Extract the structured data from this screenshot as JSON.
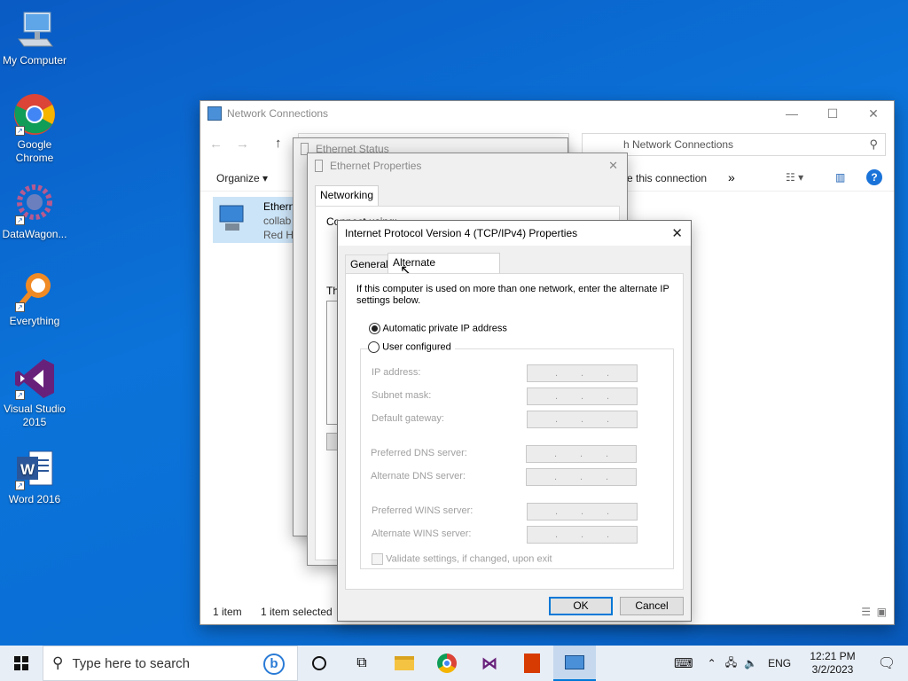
{
  "desktop": {
    "icons": [
      {
        "label": "My Computer"
      },
      {
        "label": "Google Chrome"
      },
      {
        "label": "DataWagon..."
      },
      {
        "label": "Everything"
      },
      {
        "label": "Visual Studio 2015"
      },
      {
        "label": "Word 2016"
      }
    ]
  },
  "network_window": {
    "title": "Network Connections",
    "search_placeholder": "h Network Connections",
    "toolbar_organize": "Organize",
    "toolbar_rename": "e this connection",
    "toolbar_more": "»",
    "item_name": "Ethern",
    "item_line2": "collab",
    "item_line3": "Red Ha",
    "status_count": "1 item",
    "status_selected": "1 item selected"
  },
  "ethernet_status": {
    "title": "Ethernet Status"
  },
  "ethernet_properties": {
    "title": "Ethernet Properties",
    "tab_networking": "Networking",
    "connect_using": "Connect using:",
    "this_conn": "Th"
  },
  "ipv4_dialog": {
    "title": "Internet Protocol Version 4 (TCP/IPv4) Properties",
    "tabs": [
      "General",
      "Alternate Configuration"
    ],
    "description": "If this computer is used on more than one network, enter the alternate IP settings below.",
    "radio_auto": "Automatic private IP address",
    "radio_user": "User configured",
    "fields": [
      {
        "label": "IP address:"
      },
      {
        "label": "Subnet mask:"
      },
      {
        "label": "Default gateway:"
      },
      {
        "label": "Preferred DNS server:"
      },
      {
        "label": "Alternate DNS server:"
      },
      {
        "label": "Preferred WINS server:"
      },
      {
        "label": "Alternate WINS server:"
      }
    ],
    "ip_dots": ".",
    "validate_label": "Validate settings, if changed, upon exit",
    "ok": "OK",
    "cancel": "Cancel"
  },
  "taskbar": {
    "search_placeholder": "Type here to search",
    "language": "ENG",
    "time": "12:21 PM",
    "date": "3/2/2023"
  },
  "colors": {
    "desktop": "#0b6fd6",
    "accent": "#0078d7",
    "taskbar": "#e8eef6"
  }
}
